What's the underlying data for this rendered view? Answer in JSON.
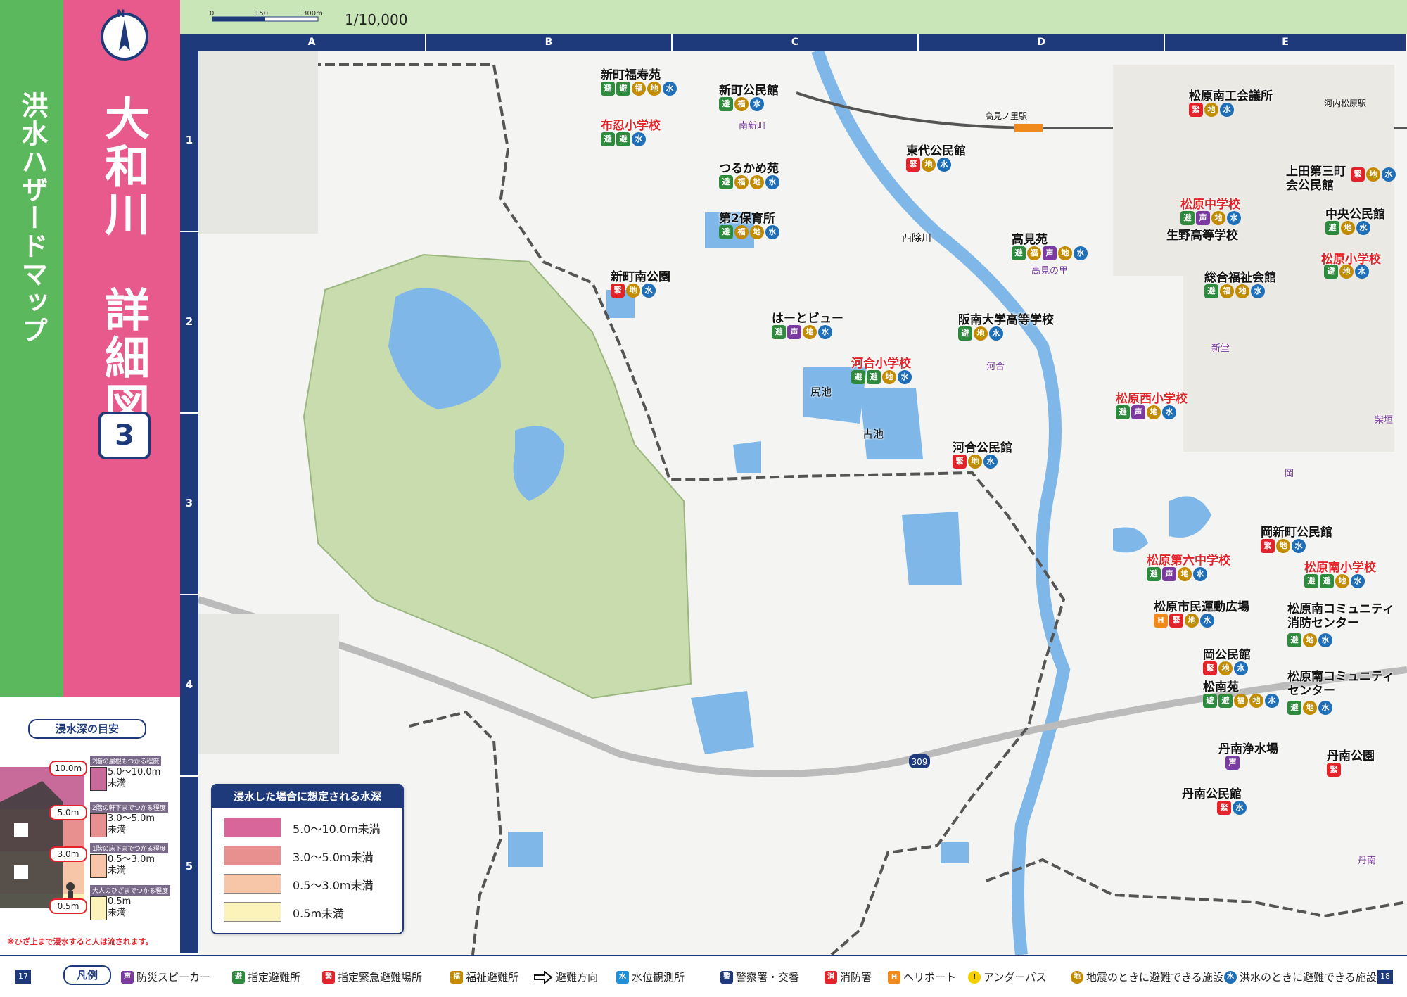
{
  "side": {
    "category": "洪水ハザードマップ",
    "title": "大和川　詳細図",
    "page_number": "3",
    "compass": "N"
  },
  "scale": {
    "ratio": "1/10,000",
    "ticks": [
      "0",
      "150",
      "300m"
    ]
  },
  "columns": [
    "A",
    "B",
    "C",
    "D",
    "E"
  ],
  "rows": [
    "1",
    "2",
    "3",
    "4",
    "5"
  ],
  "depth_guide": {
    "title": "浸水深の目安",
    "levels": [
      {
        "mark": "10.0m",
        "note": "2階の屋根もつかる程度",
        "range": "5.0～10.0m\n未満",
        "color": "#c86a9a"
      },
      {
        "mark": "5.0m",
        "note": "2階の軒下までつかる程度",
        "range": "3.0～5.0m\n未満",
        "color": "#e88f8f"
      },
      {
        "mark": "3.0m",
        "note": "1階の床下までつかる程度",
        "range": "0.5～3.0m\n未満",
        "color": "#f7c5a8"
      },
      {
        "mark": "0.5m",
        "note": "大人のひざまでつかる程度",
        "range": "0.5m\n未満",
        "color": "#fbf3b9"
      }
    ],
    "warning": "※ひざ上まで浸水すると人は流されます。"
  },
  "depth_legend": {
    "title": "浸水した場合に想定される水深",
    "items": [
      {
        "label": "5.0～10.0m未満",
        "color": "#d9669a"
      },
      {
        "label": "3.0～5.0m未満",
        "color": "#e88f8f"
      },
      {
        "label": "0.5～3.0m未満",
        "color": "#f7c5a8"
      },
      {
        "label": "0.5m未満",
        "color": "#fbf3b9"
      }
    ]
  },
  "map_labels": [
    {
      "text": "新町福寿苑",
      "style": "black",
      "icons": [
        "sh",
        "sh",
        "wf",
        "eq",
        "fl"
      ]
    },
    {
      "text": "布忍小学校",
      "style": "red",
      "icons": [
        "sh",
        "sh",
        "fl"
      ]
    },
    {
      "text": "新町公民館",
      "style": "black",
      "icons": [
        "sh",
        "wf",
        "fl"
      ]
    },
    {
      "text": "つるかめ苑",
      "style": "black",
      "icons": [
        "sh",
        "wf",
        "eq",
        "fl"
      ]
    },
    {
      "text": "第2保育所",
      "style": "black",
      "icons": [
        "sh",
        "wf",
        "eq",
        "fl"
      ]
    },
    {
      "text": "新町南公園",
      "style": "black",
      "icons": [
        "em",
        "eq",
        "fl"
      ]
    },
    {
      "text": "はーとビュー",
      "style": "black",
      "icons": [
        "sh",
        "sp",
        "eq",
        "fl"
      ]
    },
    {
      "text": "東代公民館",
      "style": "black",
      "icons": [
        "em",
        "eq",
        "fl"
      ]
    },
    {
      "text": "高見苑",
      "style": "black",
      "icons": [
        "sh",
        "wf",
        "sp",
        "eq",
        "fl"
      ]
    },
    {
      "text": "阪南大学高等学校",
      "style": "black",
      "icons": [
        "sh",
        "eq",
        "fl"
      ]
    },
    {
      "text": "河合小学校",
      "style": "red",
      "icons": [
        "sh",
        "sh",
        "eq",
        "fl"
      ]
    },
    {
      "text": "河合公民館",
      "style": "black",
      "icons": [
        "em",
        "eq",
        "fl"
      ]
    },
    {
      "text": "松原西小学校",
      "style": "red",
      "icons": [
        "sh",
        "sp",
        "eq",
        "fl"
      ]
    },
    {
      "text": "松原南工会議所",
      "style": "black",
      "icons": [
        "em",
        "eq",
        "fl"
      ]
    },
    {
      "text": "上田第三町会公民館",
      "style": "black",
      "icons": [
        "em",
        "eq",
        "fl"
      ]
    },
    {
      "text": "松原中学校",
      "style": "red",
      "icons": [
        "sh",
        "sp",
        "eq",
        "fl"
      ]
    },
    {
      "text": "中央公民館",
      "style": "black",
      "icons": [
        "sh",
        "eq",
        "fl"
      ]
    },
    {
      "text": "生野高等学校",
      "style": "black",
      "icons": []
    },
    {
      "text": "松原小学校",
      "style": "red",
      "icons": [
        "sh",
        "eq",
        "fl"
      ]
    },
    {
      "text": "総合福祉会館",
      "style": "black",
      "icons": [
        "sh",
        "wf",
        "eq",
        "fl"
      ]
    },
    {
      "text": "岡新町公民館",
      "style": "black",
      "icons": [
        "em",
        "eq",
        "fl"
      ]
    },
    {
      "text": "松原第六中学校",
      "style": "red",
      "icons": [
        "sh",
        "sp",
        "eq",
        "fl"
      ]
    },
    {
      "text": "松原南小学校",
      "style": "red",
      "icons": [
        "sh",
        "sh",
        "eq",
        "fl"
      ]
    },
    {
      "text": "松原市民運動広場",
      "style": "black",
      "icons": [
        "heli",
        "em",
        "eq",
        "fl"
      ]
    },
    {
      "text": "松原南コミュニティ消防センター",
      "style": "black",
      "icons": [
        "sh",
        "eq",
        "fl"
      ]
    },
    {
      "text": "岡公民館",
      "style": "black",
      "icons": [
        "em",
        "eq",
        "fl"
      ]
    },
    {
      "text": "松南苑",
      "style": "black",
      "icons": [
        "sh",
        "sh",
        "wf",
        "eq",
        "fl"
      ]
    },
    {
      "text": "松原南コミュニティセンター",
      "style": "black",
      "icons": [
        "sh",
        "eq",
        "fl"
      ]
    },
    {
      "text": "丹南浄水場",
      "style": "black",
      "icons": [
        "sp"
      ]
    },
    {
      "text": "丹南公園",
      "style": "black",
      "icons": [
        "em"
      ]
    },
    {
      "text": "丹南公民館",
      "style": "black",
      "icons": [
        "em",
        "fl"
      ]
    }
  ],
  "place_labels": [
    "高見ノ里駅",
    "河内松原駅",
    "西除川",
    "尻池",
    "古池",
    "河合",
    "高見の里",
    "南新町",
    "新堂",
    "岡",
    "丹南",
    "柴垣"
  ],
  "icon_glyphs": {
    "sh": "避",
    "em": "緊",
    "wf": "福",
    "eq": "地",
    "fl": "水",
    "sp": "声",
    "heli": "H"
  },
  "bottom_legend": {
    "tag": "凡例",
    "items": [
      {
        "icon": "sp",
        "label": "防災スピーカー"
      },
      {
        "icon": "sh",
        "label": "指定避難所"
      },
      {
        "icon": "em",
        "label": "指定緊急避難場所"
      },
      {
        "icon": "wf",
        "label": "福祉避難所"
      },
      {
        "icon": "arrow",
        "label": "避難方向"
      },
      {
        "icon": "fl",
        "label": "水位観測所"
      },
      {
        "icon": "police",
        "label": "警察署・交番"
      },
      {
        "icon": "fire",
        "label": "消防署"
      },
      {
        "icon": "heli",
        "label": "ヘリポート"
      },
      {
        "icon": "warn",
        "label": "アンダーパス"
      },
      {
        "icon": "eq",
        "label": "地震のときに避難できる施設"
      },
      {
        "icon": "fl",
        "label": "洪水のときに避難できる施設"
      }
    ],
    "page_left": "17",
    "page_right": "18"
  }
}
